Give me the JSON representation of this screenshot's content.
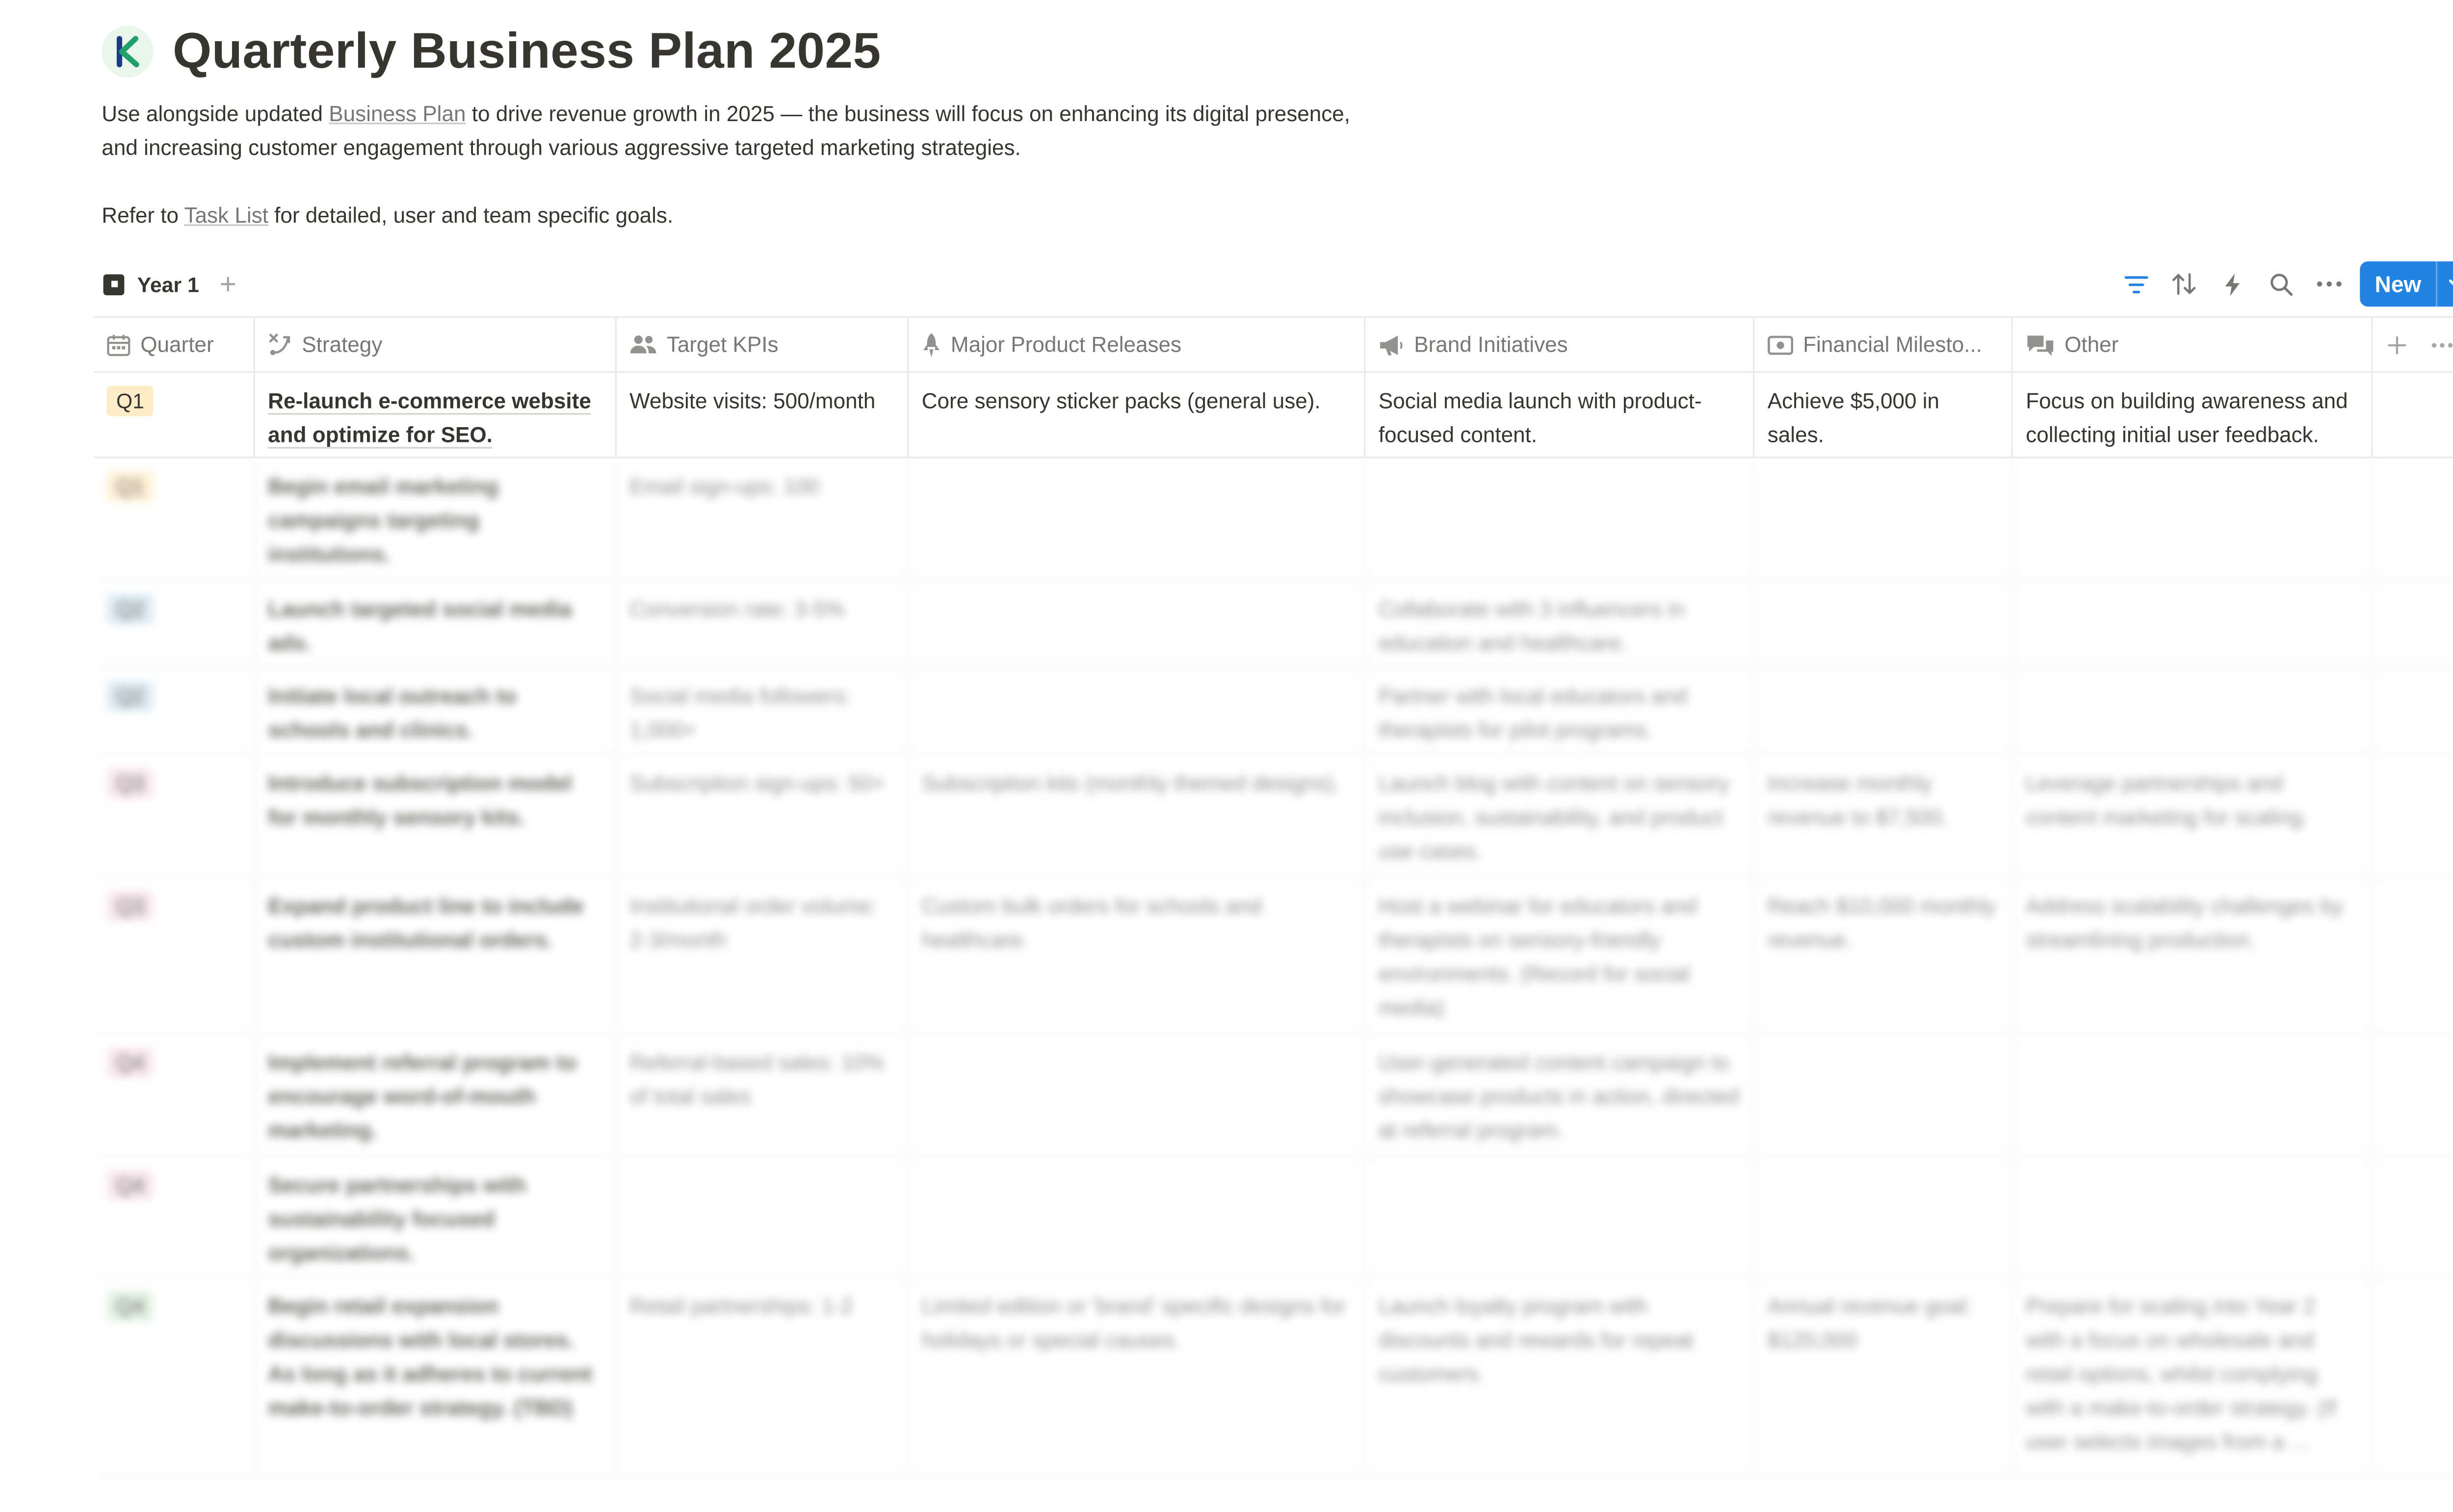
{
  "page": {
    "title": "Quarterly Business Plan 2025",
    "description": {
      "line1_prefix": "Use alongside updated ",
      "line1_link": "Business Plan",
      "line1_suffix": " to drive revenue growth in 2025 — the business will focus on enhancing its digital presence, and increasing customer engagement through various aggressive targeted marketing strategies.",
      "line2_prefix": "Refer to ",
      "line2_link": "Task List",
      "line2_suffix": " for detailed, user and team specific goals."
    },
    "logo_icon": "letter-k-logo"
  },
  "view": {
    "tab_label": "Year 1",
    "add_view_label": "+",
    "tools": [
      "filter-icon",
      "sort-icon",
      "automation-icon",
      "search-icon",
      "more-icon"
    ],
    "new_button_label": "New"
  },
  "table": {
    "columns": [
      {
        "label": "Quarter",
        "icon": "calendar-icon"
      },
      {
        "label": "Strategy",
        "icon": "strategy-icon"
      },
      {
        "label": "Target KPIs",
        "icon": "people-icon"
      },
      {
        "label": "Major Product Releases",
        "icon": "rocket-icon"
      },
      {
        "label": "Brand Initiatives",
        "icon": "megaphone-icon"
      },
      {
        "label": "Financial Milesto...",
        "icon": "money-icon"
      },
      {
        "label": "Other",
        "icon": "chat-icon"
      }
    ],
    "rows": [
      {
        "quarter": "Q1",
        "badge_color": "#fdecc8",
        "strategy": "Re-launch e-commerce website and optimize for SEO.",
        "kpis": "Website visits: 500/month",
        "releases": "Core sensory sticker packs (general use).",
        "brand": "Social media launch with product-focused content.",
        "financial": "Achieve $5,000 in sales.",
        "other": "Focus on building awareness and collecting initial user feedback.",
        "blurred": false
      },
      {
        "quarter": "Q1",
        "badge_color": "#fdecc8",
        "strategy": "Begin email marketing campaigns targeting institutions.",
        "kpis": "Email sign-ups: 100",
        "releases": "",
        "brand": "",
        "financial": "",
        "other": "",
        "blurred": true
      },
      {
        "quarter": "Q2",
        "badge_color": "#d3e5ef",
        "strategy": "Launch targeted social media ads.",
        "kpis": "Conversion rate: 3-5%",
        "releases": "",
        "brand": "Collaborate with 3 influencers in education and healthcare.",
        "financial": "",
        "other": "",
        "blurred": true
      },
      {
        "quarter": "Q2",
        "badge_color": "#d3e5ef",
        "strategy": "Initiate local outreach to schools and clinics.",
        "kpis": "Social media followers: 1,000+",
        "releases": "",
        "brand": "Partner with local educators and therapists for pilot programs.",
        "financial": "",
        "other": "",
        "blurred": true
      },
      {
        "quarter": "Q3",
        "badge_color": "#f5e0e9",
        "strategy": "Introduce subscription model for monthly sensory kits.",
        "kpis": "Subscription sign-ups: 50+",
        "releases": "Subscription kits (monthly themed designs).",
        "brand": "Launch blog with content on sensory inclusion, sustainability, and product use cases.",
        "financial": "Increase monthly revenue to $7,500.",
        "other": "Leverage partnerships and content marketing for scaling.",
        "blurred": true
      },
      {
        "quarter": "Q3",
        "badge_color": "#f5e0e9",
        "strategy": "Expand product line to include custom institutional orders.",
        "kpis": "Institutional order volume: 2-3/month",
        "releases": "Custom bulk orders for schools and healthcare.",
        "brand": "Host a webinar for educators and therapists on sensory-friendly environments. (Record for social media)",
        "financial": "Reach $10,000 monthly revenue.",
        "other": "Address scalability challenges by streamlining production.",
        "blurred": true
      },
      {
        "quarter": "Q4",
        "badge_color": "#f5e0e9",
        "strategy": "Implement referral program to encourage word-of-mouth marketing.",
        "kpis": "Referral-based sales: 10% of total sales",
        "releases": "",
        "brand": "User-generated content campaign to showcase products in action, directed at referral program.",
        "financial": "",
        "other": "",
        "blurred": true
      },
      {
        "quarter": "Q4",
        "badge_color": "#f5e0e9",
        "strategy": "Secure partnerships with sustainability focused organizations.",
        "kpis": "",
        "releases": "",
        "brand": "",
        "financial": "",
        "other": "",
        "blurred": true
      },
      {
        "quarter": "Q4",
        "badge_color": "#dbeddb",
        "strategy": "Begin retail expansion discussions with local stores. As long as it adheres to current make-to-order strategy. (TBD)",
        "kpis": "Retail partnerships: 1-2",
        "releases": "Limited edition or 'brand' specific designs for holidays or special causes.",
        "brand": "Launch loyalty program with discounts and rewards for repeat customers.",
        "financial": "Annual revenue goal: $120,000",
        "other": "Prepare for scaling into Year 2 with a focus on wholesale and retail options, whilst complying with a make-to-order strategy. (If user selects images from a …",
        "blurred": true
      }
    ]
  },
  "colors": {
    "accent": "#2383e2",
    "text": "#37352f",
    "muted": "#787774",
    "border": "#e9e9e7"
  }
}
